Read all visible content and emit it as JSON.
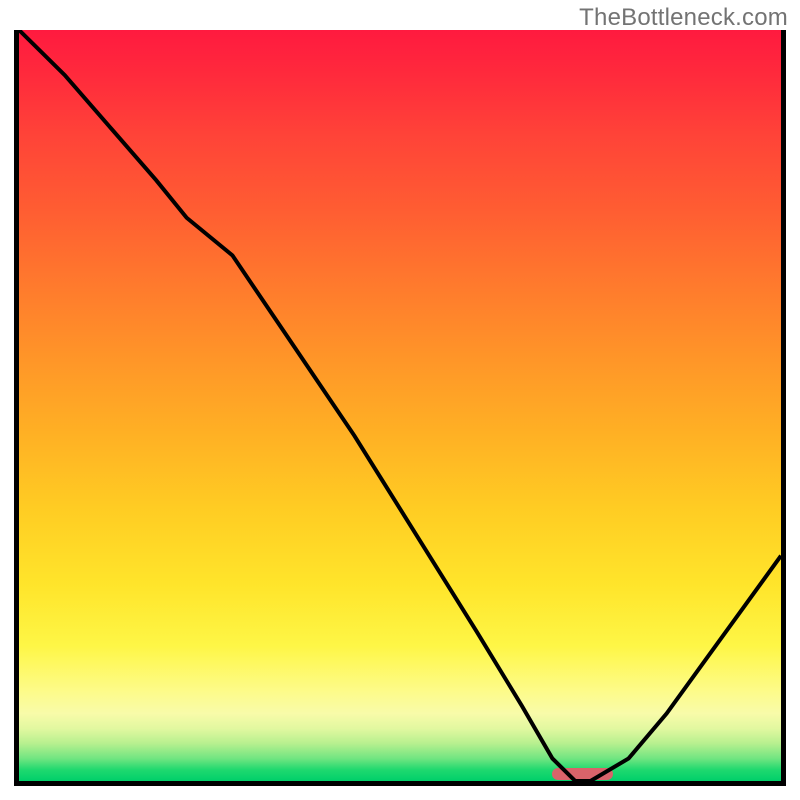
{
  "watermark": "TheBottleneck.com",
  "colors": {
    "border": "#000000",
    "curve": "#000000",
    "marker": "#d9636a",
    "gradient_top": "#ff1a3f",
    "gradient_bottom": "#00cf6a"
  },
  "chart_data": {
    "type": "line",
    "title": "",
    "xlabel": "",
    "ylabel": "",
    "xlim": [
      0,
      100
    ],
    "ylim": [
      0,
      100
    ],
    "grid": false,
    "series": [
      {
        "name": "bottleneck-curve",
        "x": [
          0,
          6,
          12,
          18,
          22,
          28,
          36,
          44,
          52,
          60,
          66,
          70,
          73,
          75,
          80,
          85,
          90,
          95,
          100
        ],
        "y": [
          100,
          94,
          87,
          80,
          75,
          70,
          58,
          46,
          33,
          20,
          10,
          3,
          0,
          0,
          3,
          9,
          16,
          23,
          30
        ]
      }
    ],
    "marker": {
      "x_center": 74,
      "y": 0,
      "width_pct": 8,
      "height_pct": 1.6
    },
    "background": "rainbow-vertical-gradient",
    "legend": false
  }
}
